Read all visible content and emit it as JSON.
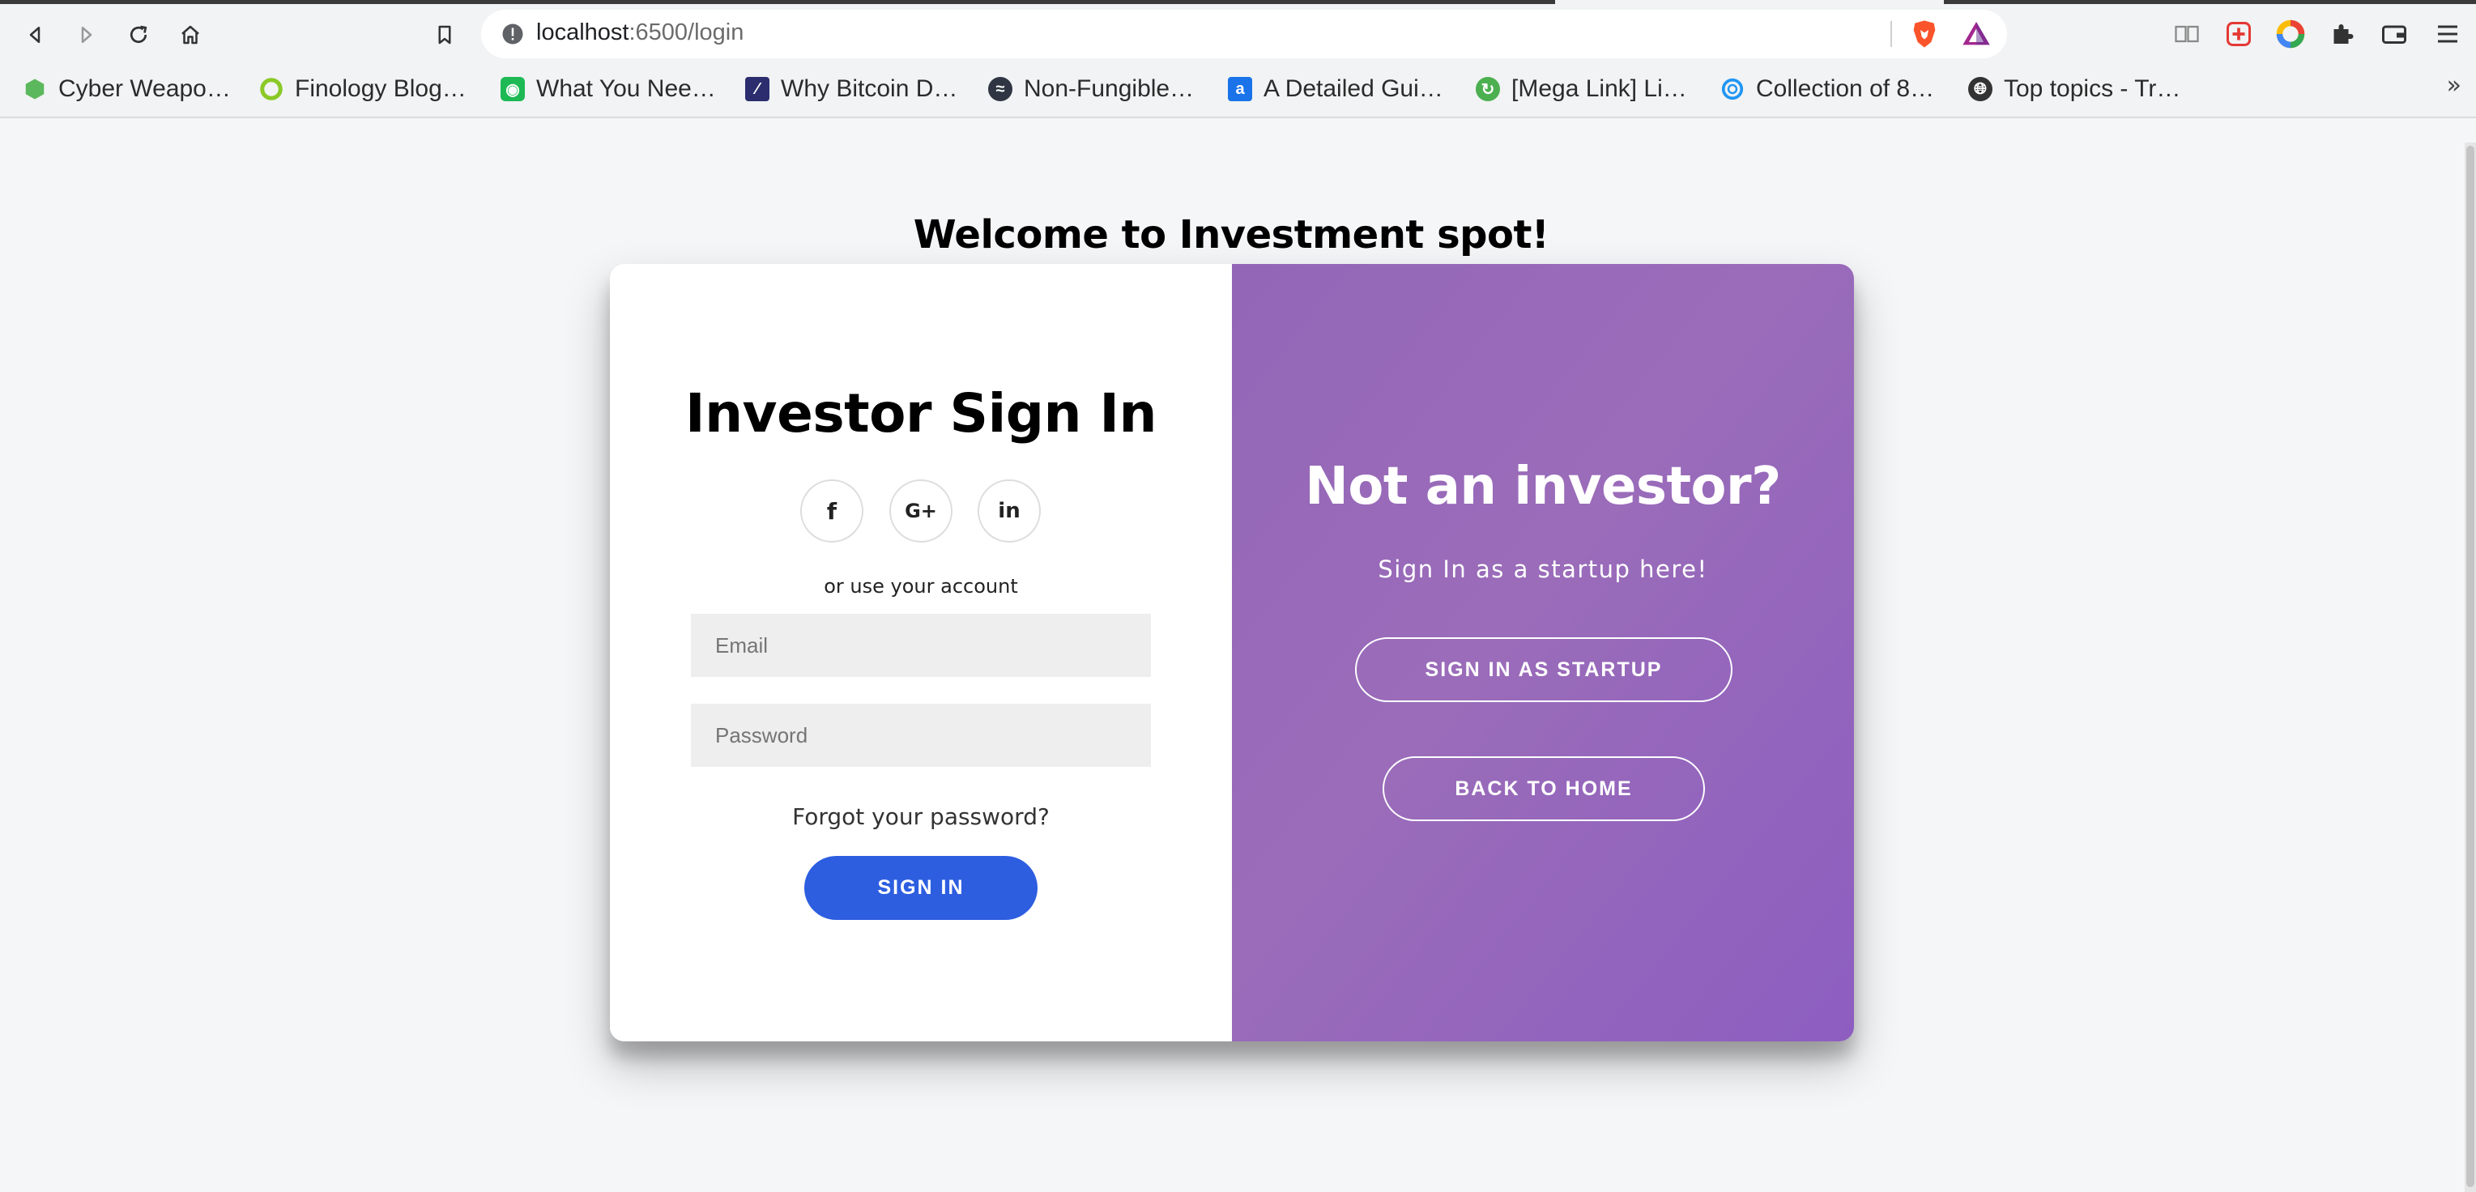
{
  "browser": {
    "url_host": "localhost",
    "url_path": ":6500/login",
    "bookmarks": [
      {
        "label": "Cyber Weapo…",
        "color": "#5cb85c"
      },
      {
        "label": "Finology Blog…",
        "color": "#8ac926"
      },
      {
        "label": "What You Nee…",
        "color": "#1db954"
      },
      {
        "label": "Why Bitcoin D…",
        "color": "#2b2d6e"
      },
      {
        "label": "Non-Fungible…",
        "color": "#2f3542"
      },
      {
        "label": "A Detailed Gui…",
        "color": "#1a73e8"
      },
      {
        "label": "[Mega Link] Li…",
        "color": "#4caf50"
      },
      {
        "label": "Collection of 8…",
        "color": "#2196f3"
      },
      {
        "label": "Top topics - Tr…",
        "color": "#333333"
      }
    ],
    "more_label": "»"
  },
  "page": {
    "welcome": "Welcome to Investment spot!",
    "signin": {
      "title": "Investor Sign In",
      "social": {
        "facebook": "f",
        "google": "G+",
        "linkedin": "in"
      },
      "or_use": "or use your account",
      "email_placeholder": "Email",
      "password_placeholder": "Password",
      "forgot": "Forgot your password?",
      "button": "SIGN IN"
    },
    "overlay": {
      "title": "Not an investor?",
      "hint": "Sign In as a startup here!",
      "startup_button": "SIGN IN AS STARTUP",
      "home_button": "BACK TO HOME"
    }
  }
}
